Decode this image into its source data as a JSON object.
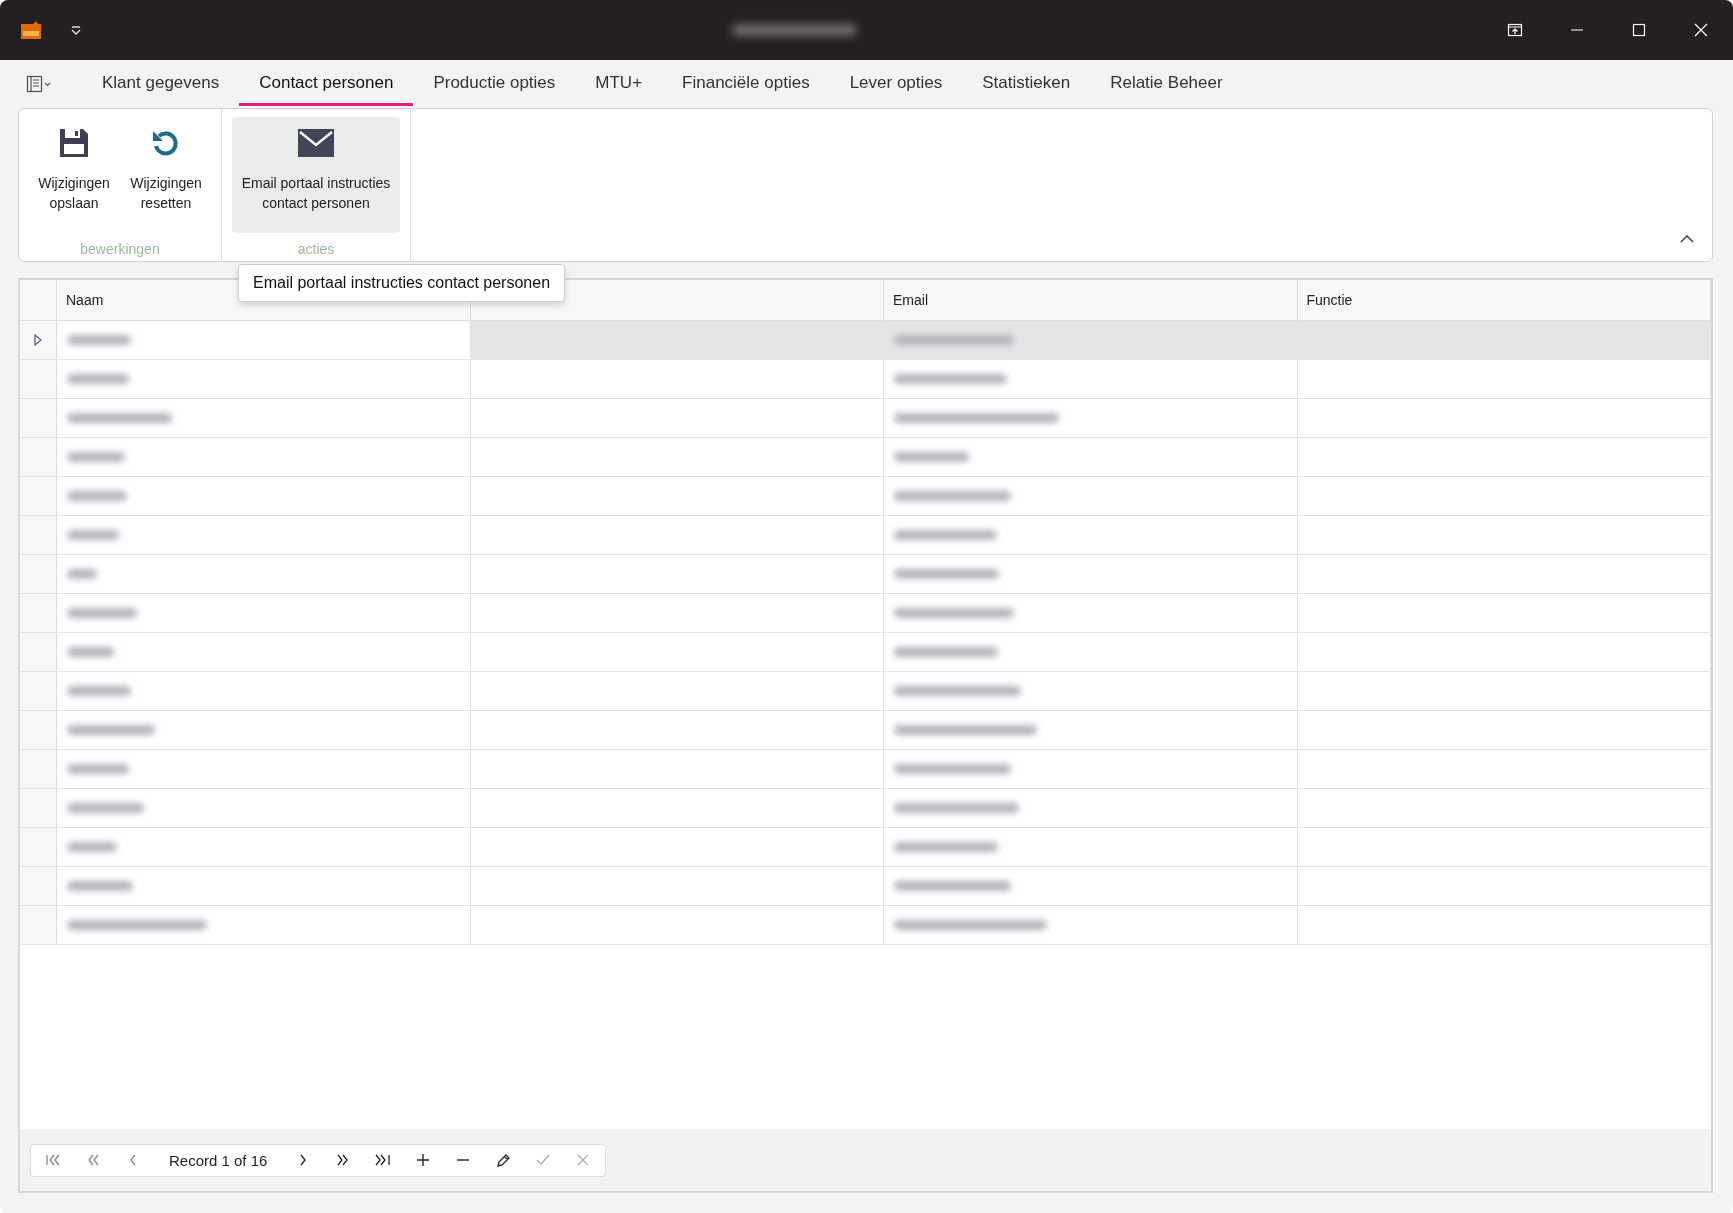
{
  "menu_tabs": [
    {
      "label": "Klant gegevens",
      "selected": false
    },
    {
      "label": "Contact personen",
      "selected": true
    },
    {
      "label": "Productie opties",
      "selected": false
    },
    {
      "label": "MTU+",
      "selected": false
    },
    {
      "label": "Financiële opties",
      "selected": false
    },
    {
      "label": "Lever opties",
      "selected": false
    },
    {
      "label": "Statistieken",
      "selected": false
    },
    {
      "label": "Relatie Beheer",
      "selected": false
    }
  ],
  "ribbon_groups": [
    {
      "label": "bewerkingen",
      "buttons": [
        {
          "kind": "save",
          "label": "Wijzigingen opslaan",
          "hovered": false
        },
        {
          "kind": "reset",
          "label": "Wijzigingen resetten",
          "hovered": false
        }
      ]
    },
    {
      "label": "acties",
      "buttons": [
        {
          "kind": "email",
          "label": "Email portaal instructies contact personen",
          "hovered": true
        }
      ]
    }
  ],
  "tooltip": "Email portaal instructies contact personen",
  "table": {
    "columns": [
      "Naam",
      "Email",
      "Functie"
    ],
    "rows": [
      {
        "selected": true
      },
      {
        "selected": false
      },
      {
        "selected": false
      },
      {
        "selected": false
      },
      {
        "selected": false
      },
      {
        "selected": false
      },
      {
        "selected": false
      },
      {
        "selected": false
      },
      {
        "selected": false
      },
      {
        "selected": false
      },
      {
        "selected": false
      },
      {
        "selected": false
      },
      {
        "selected": false
      },
      {
        "selected": false
      },
      {
        "selected": false
      },
      {
        "selected": false
      }
    ]
  },
  "navigator": {
    "record": "Record 1 of 16"
  }
}
